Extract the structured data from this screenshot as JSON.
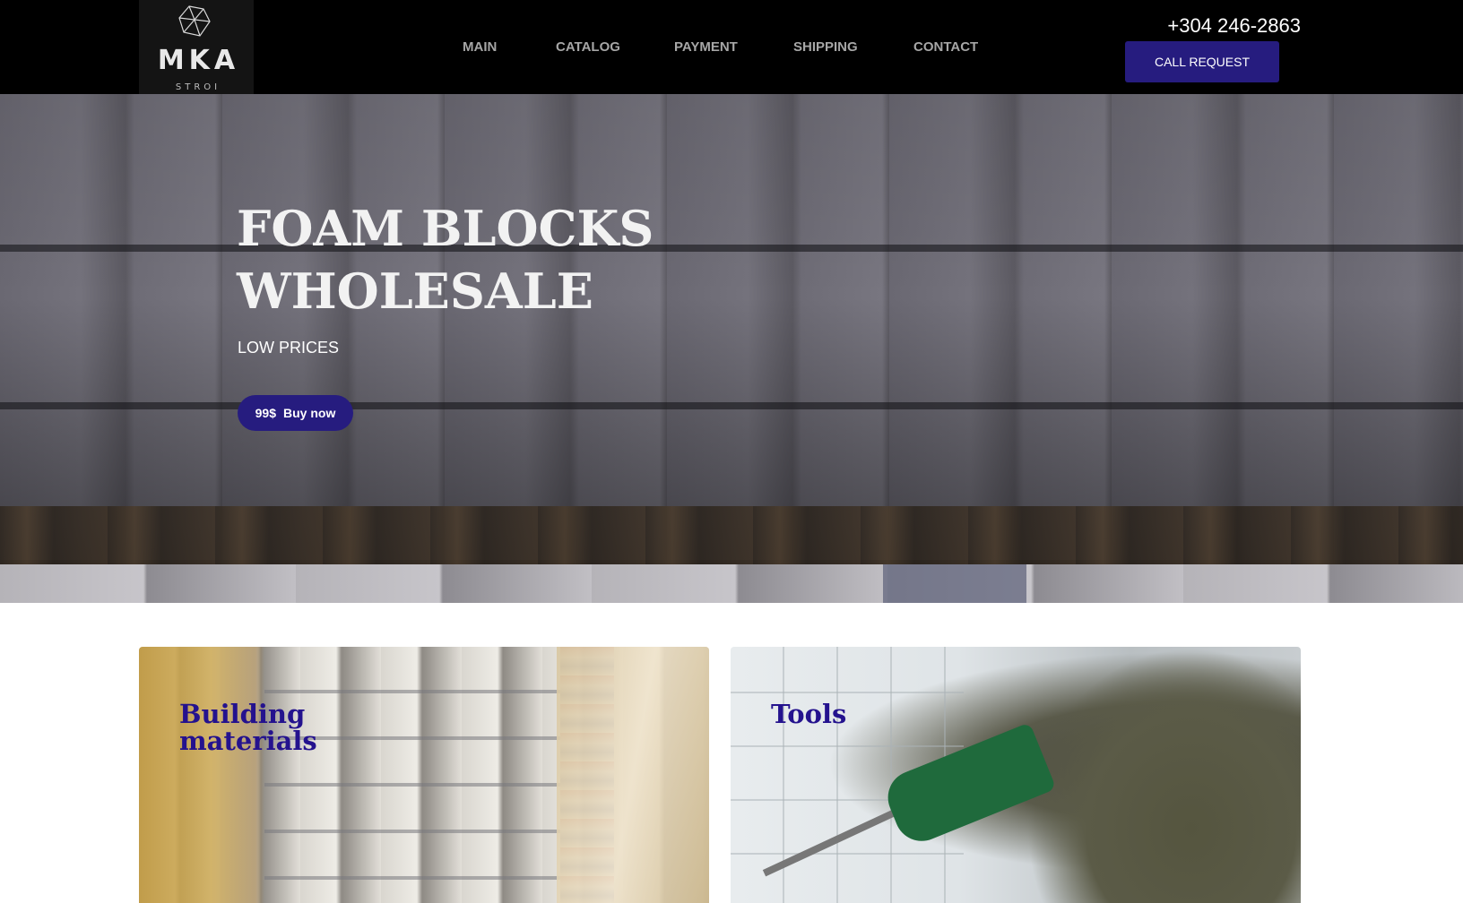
{
  "logo": {
    "main": "MKA",
    "sub": "STROI",
    "icon": "gem-icon"
  },
  "nav": {
    "items": [
      {
        "label": "MAIN"
      },
      {
        "label": "CATALOG"
      },
      {
        "label": "PAYMENT"
      },
      {
        "label": "SHIPPING"
      },
      {
        "label": "CONTACT"
      }
    ]
  },
  "contact": {
    "phone": "+304 246-2863",
    "call_button": "CALL REQUEST"
  },
  "hero": {
    "title_line1": "FOAM BLOCKS",
    "title_line2": "WHOLESALE",
    "subtitle": "LOW PRICES",
    "price": "99$",
    "buy_label": "Buy now"
  },
  "categories": [
    {
      "title_line1": "Building",
      "title_line2": "materials"
    },
    {
      "title_line1": "Tools"
    }
  ],
  "colors": {
    "header_bg": "#000000",
    "accent": "#261c7f",
    "category_title": "#24128e",
    "nav_text": "#a6a6a6"
  }
}
